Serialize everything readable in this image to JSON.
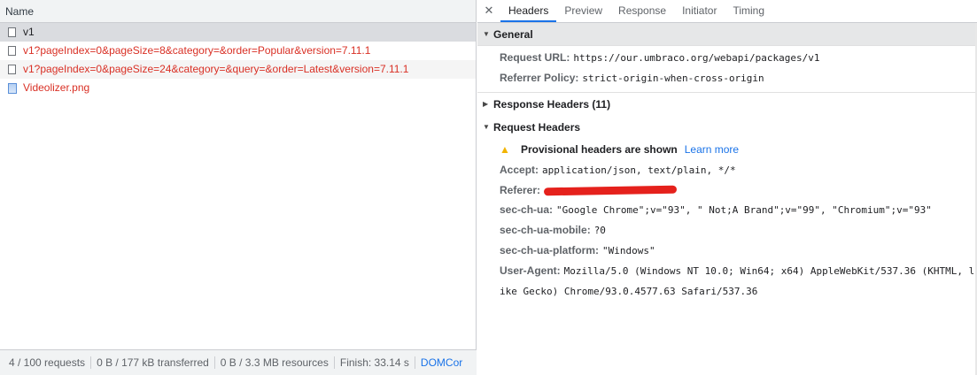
{
  "requests": {
    "column_header": "Name",
    "items": [
      {
        "label": "v1",
        "icon": "document-icon",
        "state": "selected"
      },
      {
        "label": "v1?pageIndex=0&pageSize=8&category=&order=Popular&version=7.11.1",
        "icon": "document-icon",
        "state": "failed"
      },
      {
        "label": "v1?pageIndex=0&pageSize=24&category=&query=&order=Latest&version=7.11.1",
        "icon": "document-icon",
        "state": "failed"
      },
      {
        "label": "Videolizer.png",
        "icon": "image-icon",
        "state": "failed"
      }
    ]
  },
  "status_bar": {
    "requests": "4 / 100 requests",
    "transferred": "0 B / 177 kB transferred",
    "resources": "0 B / 3.3 MB resources",
    "finish": "Finish: 33.14 s",
    "domcontent": "DOMCor"
  },
  "details": {
    "close_glyph": "✕",
    "tabs": [
      "Headers",
      "Preview",
      "Response",
      "Initiator",
      "Timing"
    ],
    "active_tab": "Headers",
    "general": {
      "title": "General",
      "request_url_label": "Request URL:",
      "request_url": "https://our.umbraco.org/webapi/packages/v1",
      "referrer_policy_label": "Referrer Policy:",
      "referrer_policy": "strict-origin-when-cross-origin"
    },
    "response_headers": {
      "title": "Response Headers (11)"
    },
    "request_headers": {
      "title": "Request Headers",
      "warning": "Provisional headers are shown",
      "learn_more": "Learn more",
      "accept_label": "Accept:",
      "accept": "application/json, text/plain, */*",
      "referer_label": "Referer:",
      "sec_ch_ua_label": "sec-ch-ua:",
      "sec_ch_ua": "\"Google Chrome\";v=\"93\", \" Not;A Brand\";v=\"99\", \"Chromium\";v=\"93\"",
      "sec_ch_ua_mobile_label": "sec-ch-ua-mobile:",
      "sec_ch_ua_mobile": "?0",
      "sec_ch_ua_platform_label": "sec-ch-ua-platform:",
      "sec_ch_ua_platform": "\"Windows\"",
      "user_agent_label": "User-Agent:",
      "user_agent_line1": "Mozilla/5.0 (Windows NT 10.0; Win64; x64) AppleWebKit/537.36 (KHTML, l",
      "user_agent_line2": "ike Gecko) Chrome/93.0.4577.63 Safari/537.36"
    }
  },
  "colors": {
    "accent": "#1a73e8",
    "failed": "#d93025",
    "redaction": "#e5211c",
    "warning": "#f2b400"
  }
}
